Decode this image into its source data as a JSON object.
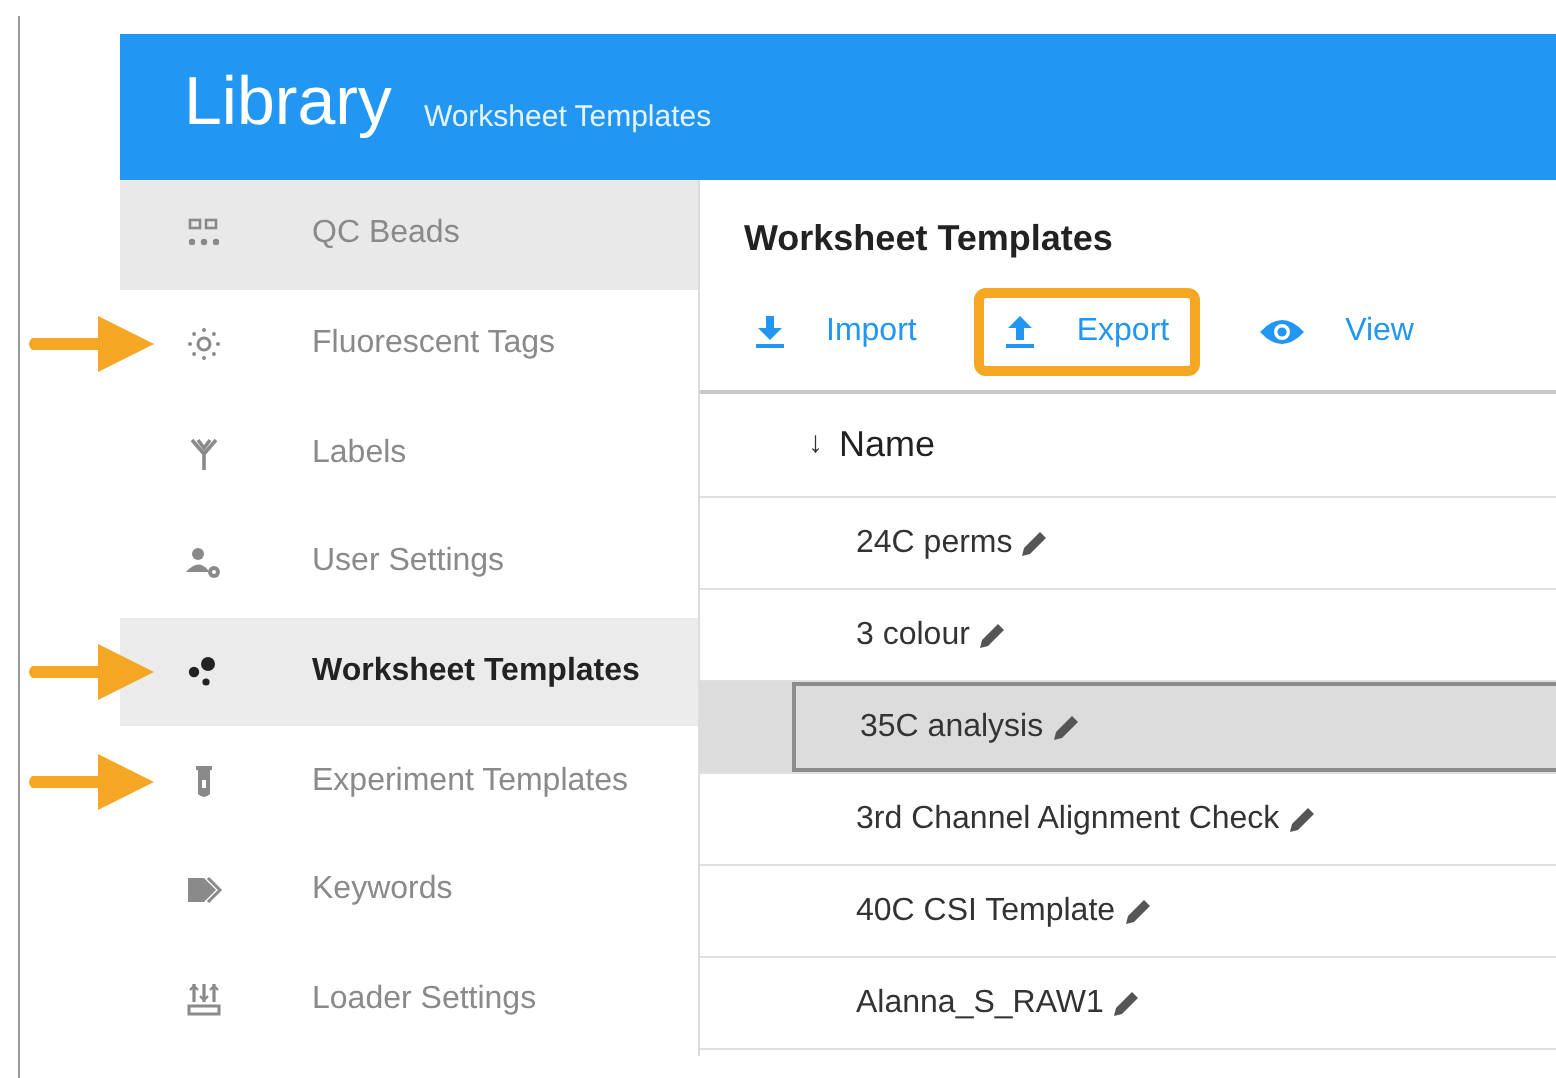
{
  "header": {
    "title": "Library",
    "subtitle": "Worksheet Templates"
  },
  "sidebar": {
    "items": [
      {
        "label": "QC Beads",
        "kind": "qc",
        "selected": false,
        "hovered": true,
        "annotated": false
      },
      {
        "label": "Fluorescent Tags",
        "kind": "sun",
        "selected": false,
        "hovered": false,
        "annotated": true
      },
      {
        "label": "Labels",
        "kind": "antibody",
        "selected": false,
        "hovered": false,
        "annotated": false
      },
      {
        "label": "User Settings",
        "kind": "user",
        "selected": false,
        "hovered": false,
        "annotated": false
      },
      {
        "label": "Worksheet Templates",
        "kind": "dots",
        "selected": true,
        "hovered": false,
        "annotated": true
      },
      {
        "label": "Experiment Templates",
        "kind": "tube",
        "selected": false,
        "hovered": false,
        "annotated": true
      },
      {
        "label": "Keywords",
        "kind": "tags",
        "selected": false,
        "hovered": false,
        "annotated": false
      },
      {
        "label": "Loader Settings",
        "kind": "loader",
        "selected": false,
        "hovered": false,
        "annotated": false
      }
    ]
  },
  "content": {
    "title": "Worksheet Templates",
    "toolbar": [
      {
        "label": "Import",
        "kind": "download",
        "highlighted": false
      },
      {
        "label": "Export",
        "kind": "upload",
        "highlighted": true
      },
      {
        "label": "View",
        "kind": "eye",
        "highlighted": false
      }
    ],
    "table": {
      "column": "Name",
      "sort": "↓",
      "rows": [
        {
          "name": "24C perms",
          "selected": false
        },
        {
          "name": "3 colour",
          "selected": false
        },
        {
          "name": "35C analysis",
          "selected": true
        },
        {
          "name": "3rd Channel Alignment Check",
          "selected": false
        },
        {
          "name": "40C CSI Template",
          "selected": false
        },
        {
          "name": "Alanna_S_RAW1",
          "selected": false
        }
      ]
    }
  }
}
